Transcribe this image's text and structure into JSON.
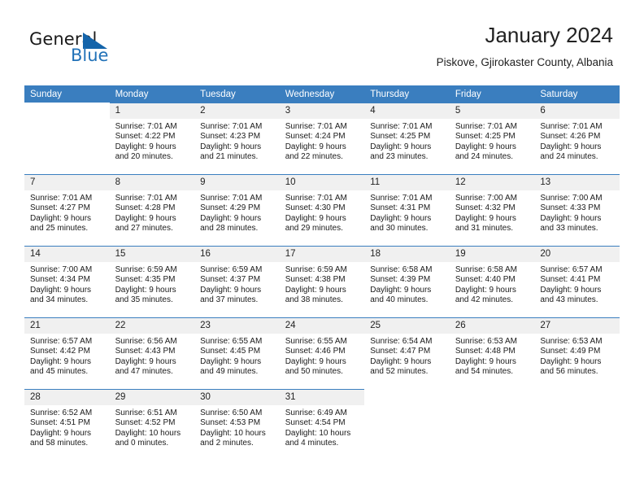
{
  "brand": {
    "general": "General",
    "blue": "Blue",
    "logo_icon": "triangle-logo-icon"
  },
  "header": {
    "title": "January 2024",
    "subtitle": "Piskove, Gjirokaster County, Albania"
  },
  "theme": {
    "header_blue": "#3a7ebf",
    "brand_blue": "#2272b8",
    "daynum_bg": "#f0f0f0",
    "text": "#1a1a1a"
  },
  "weekdays": [
    "Sunday",
    "Monday",
    "Tuesday",
    "Wednesday",
    "Thursday",
    "Friday",
    "Saturday"
  ],
  "labels": {
    "sunrise_prefix": "Sunrise:",
    "sunset_prefix": "Sunset:",
    "daylight_prefix": "Daylight:"
  },
  "weeks": [
    [
      {
        "empty": true
      },
      {
        "day": "1",
        "sunrise": "Sunrise: 7:01 AM",
        "sunset": "Sunset: 4:22 PM",
        "daylight1": "Daylight: 9 hours",
        "daylight2": "and 20 minutes."
      },
      {
        "day": "2",
        "sunrise": "Sunrise: 7:01 AM",
        "sunset": "Sunset: 4:23 PM",
        "daylight1": "Daylight: 9 hours",
        "daylight2": "and 21 minutes."
      },
      {
        "day": "3",
        "sunrise": "Sunrise: 7:01 AM",
        "sunset": "Sunset: 4:24 PM",
        "daylight1": "Daylight: 9 hours",
        "daylight2": "and 22 minutes."
      },
      {
        "day": "4",
        "sunrise": "Sunrise: 7:01 AM",
        "sunset": "Sunset: 4:25 PM",
        "daylight1": "Daylight: 9 hours",
        "daylight2": "and 23 minutes."
      },
      {
        "day": "5",
        "sunrise": "Sunrise: 7:01 AM",
        "sunset": "Sunset: 4:25 PM",
        "daylight1": "Daylight: 9 hours",
        "daylight2": "and 24 minutes."
      },
      {
        "day": "6",
        "sunrise": "Sunrise: 7:01 AM",
        "sunset": "Sunset: 4:26 PM",
        "daylight1": "Daylight: 9 hours",
        "daylight2": "and 24 minutes."
      }
    ],
    [
      {
        "day": "7",
        "sunrise": "Sunrise: 7:01 AM",
        "sunset": "Sunset: 4:27 PM",
        "daylight1": "Daylight: 9 hours",
        "daylight2": "and 25 minutes."
      },
      {
        "day": "8",
        "sunrise": "Sunrise: 7:01 AM",
        "sunset": "Sunset: 4:28 PM",
        "daylight1": "Daylight: 9 hours",
        "daylight2": "and 27 minutes."
      },
      {
        "day": "9",
        "sunrise": "Sunrise: 7:01 AM",
        "sunset": "Sunset: 4:29 PM",
        "daylight1": "Daylight: 9 hours",
        "daylight2": "and 28 minutes."
      },
      {
        "day": "10",
        "sunrise": "Sunrise: 7:01 AM",
        "sunset": "Sunset: 4:30 PM",
        "daylight1": "Daylight: 9 hours",
        "daylight2": "and 29 minutes."
      },
      {
        "day": "11",
        "sunrise": "Sunrise: 7:01 AM",
        "sunset": "Sunset: 4:31 PM",
        "daylight1": "Daylight: 9 hours",
        "daylight2": "and 30 minutes."
      },
      {
        "day": "12",
        "sunrise": "Sunrise: 7:00 AM",
        "sunset": "Sunset: 4:32 PM",
        "daylight1": "Daylight: 9 hours",
        "daylight2": "and 31 minutes."
      },
      {
        "day": "13",
        "sunrise": "Sunrise: 7:00 AM",
        "sunset": "Sunset: 4:33 PM",
        "daylight1": "Daylight: 9 hours",
        "daylight2": "and 33 minutes."
      }
    ],
    [
      {
        "day": "14",
        "sunrise": "Sunrise: 7:00 AM",
        "sunset": "Sunset: 4:34 PM",
        "daylight1": "Daylight: 9 hours",
        "daylight2": "and 34 minutes."
      },
      {
        "day": "15",
        "sunrise": "Sunrise: 6:59 AM",
        "sunset": "Sunset: 4:35 PM",
        "daylight1": "Daylight: 9 hours",
        "daylight2": "and 35 minutes."
      },
      {
        "day": "16",
        "sunrise": "Sunrise: 6:59 AM",
        "sunset": "Sunset: 4:37 PM",
        "daylight1": "Daylight: 9 hours",
        "daylight2": "and 37 minutes."
      },
      {
        "day": "17",
        "sunrise": "Sunrise: 6:59 AM",
        "sunset": "Sunset: 4:38 PM",
        "daylight1": "Daylight: 9 hours",
        "daylight2": "and 38 minutes."
      },
      {
        "day": "18",
        "sunrise": "Sunrise: 6:58 AM",
        "sunset": "Sunset: 4:39 PM",
        "daylight1": "Daylight: 9 hours",
        "daylight2": "and 40 minutes."
      },
      {
        "day": "19",
        "sunrise": "Sunrise: 6:58 AM",
        "sunset": "Sunset: 4:40 PM",
        "daylight1": "Daylight: 9 hours",
        "daylight2": "and 42 minutes."
      },
      {
        "day": "20",
        "sunrise": "Sunrise: 6:57 AM",
        "sunset": "Sunset: 4:41 PM",
        "daylight1": "Daylight: 9 hours",
        "daylight2": "and 43 minutes."
      }
    ],
    [
      {
        "day": "21",
        "sunrise": "Sunrise: 6:57 AM",
        "sunset": "Sunset: 4:42 PM",
        "daylight1": "Daylight: 9 hours",
        "daylight2": "and 45 minutes."
      },
      {
        "day": "22",
        "sunrise": "Sunrise: 6:56 AM",
        "sunset": "Sunset: 4:43 PM",
        "daylight1": "Daylight: 9 hours",
        "daylight2": "and 47 minutes."
      },
      {
        "day": "23",
        "sunrise": "Sunrise: 6:55 AM",
        "sunset": "Sunset: 4:45 PM",
        "daylight1": "Daylight: 9 hours",
        "daylight2": "and 49 minutes."
      },
      {
        "day": "24",
        "sunrise": "Sunrise: 6:55 AM",
        "sunset": "Sunset: 4:46 PM",
        "daylight1": "Daylight: 9 hours",
        "daylight2": "and 50 minutes."
      },
      {
        "day": "25",
        "sunrise": "Sunrise: 6:54 AM",
        "sunset": "Sunset: 4:47 PM",
        "daylight1": "Daylight: 9 hours",
        "daylight2": "and 52 minutes."
      },
      {
        "day": "26",
        "sunrise": "Sunrise: 6:53 AM",
        "sunset": "Sunset: 4:48 PM",
        "daylight1": "Daylight: 9 hours",
        "daylight2": "and 54 minutes."
      },
      {
        "day": "27",
        "sunrise": "Sunrise: 6:53 AM",
        "sunset": "Sunset: 4:49 PM",
        "daylight1": "Daylight: 9 hours",
        "daylight2": "and 56 minutes."
      }
    ],
    [
      {
        "day": "28",
        "sunrise": "Sunrise: 6:52 AM",
        "sunset": "Sunset: 4:51 PM",
        "daylight1": "Daylight: 9 hours",
        "daylight2": "and 58 minutes."
      },
      {
        "day": "29",
        "sunrise": "Sunrise: 6:51 AM",
        "sunset": "Sunset: 4:52 PM",
        "daylight1": "Daylight: 10 hours",
        "daylight2": "and 0 minutes."
      },
      {
        "day": "30",
        "sunrise": "Sunrise: 6:50 AM",
        "sunset": "Sunset: 4:53 PM",
        "daylight1": "Daylight: 10 hours",
        "daylight2": "and 2 minutes."
      },
      {
        "day": "31",
        "sunrise": "Sunrise: 6:49 AM",
        "sunset": "Sunset: 4:54 PM",
        "daylight1": "Daylight: 10 hours",
        "daylight2": "and 4 minutes."
      },
      {
        "empty": true
      },
      {
        "empty": true
      },
      {
        "empty": true
      }
    ]
  ]
}
